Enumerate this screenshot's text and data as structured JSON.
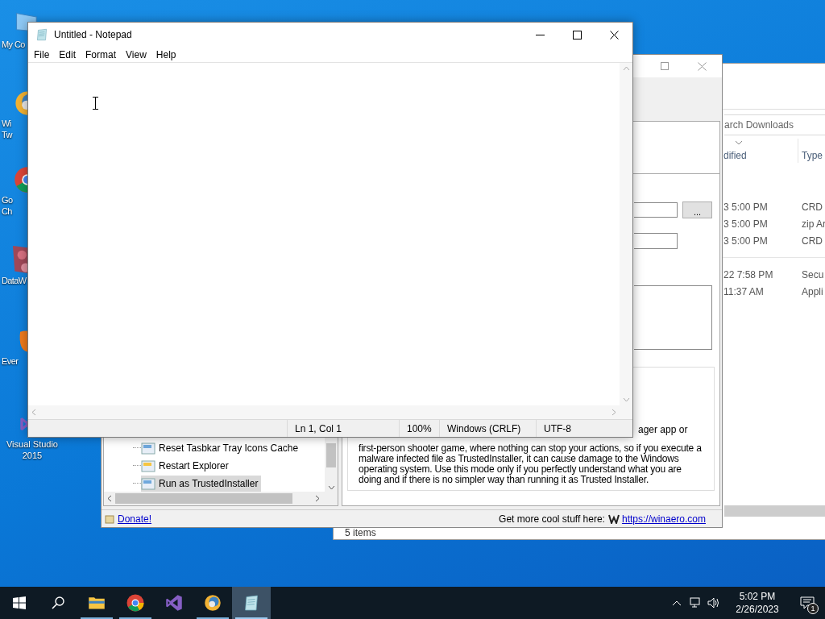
{
  "desktop_icons": [
    {
      "kind": "computer",
      "lines": [
        "My Co"
      ]
    },
    {
      "kind": "tweaker",
      "lines": [
        "Wi",
        "Tw"
      ]
    },
    {
      "kind": "chrome",
      "lines": [
        "Go",
        "Ch"
      ]
    },
    {
      "kind": "datawarrior",
      "lines": [
        "DataW"
      ]
    },
    {
      "kind": "evernote",
      "lines": [
        "Ever"
      ]
    },
    {
      "kind": "visualstudio",
      "lines": [
        "Visual Studio",
        "2015"
      ]
    }
  ],
  "explorer": {
    "search_placeholder": "arch Downloads",
    "columns": [
      "dified",
      "Type"
    ],
    "row_groups": [
      [
        {
          "date": "3 5:00 PM",
          "type": "CRD"
        },
        {
          "date": "3 5:00 PM",
          "type": "zip Ar"
        },
        {
          "date": "3 5:00 PM",
          "type": "CRD"
        }
      ],
      [
        {
          "date": "22 7:58 PM",
          "type": "Secu"
        },
        {
          "date": "11:37 AM",
          "type": "Appli"
        }
      ]
    ],
    "status": "5 items"
  },
  "tweaker": {
    "browse_button": "...",
    "tree_items": [
      {
        "label": "Reset Tasbkar Tray Icons Cache",
        "selected": false
      },
      {
        "label": "Restart Explorer",
        "selected": false
      },
      {
        "label": "Run as TrustedInstaller",
        "selected": true
      }
    ],
    "description_fragment": "ager app or",
    "description": "first-person shooter game, where nothing can stop your actions, so if you execute a malware infected file as TrustedInstaller, it can cause damage to the Windows operating system. Use this mode only if you perfectly understand what you are doing and if there is no simpler way than running it as Trusted Installer.",
    "donate": "Donate!",
    "promo": "Get more cool stuff here:",
    "link": "https://winaero.com"
  },
  "notepad": {
    "title": "Untitled - Notepad",
    "menu": [
      "File",
      "Edit",
      "Format",
      "View",
      "Help"
    ],
    "status": [
      "Ln 1, Col 1",
      "100%",
      "Windows (CRLF)",
      "UTF-8"
    ]
  },
  "taskbar": {
    "apps": [
      {
        "kind": "explorer",
        "running": true,
        "selected": false
      },
      {
        "kind": "chrome",
        "running": true,
        "selected": false
      },
      {
        "kind": "visualstudio",
        "running": false,
        "selected": false
      },
      {
        "kind": "tweaker",
        "running": true,
        "selected": false
      },
      {
        "kind": "notepad",
        "running": true,
        "selected": true
      }
    ],
    "time": "5:02 PM",
    "date": "2/26/2023",
    "notification_count": "1"
  }
}
